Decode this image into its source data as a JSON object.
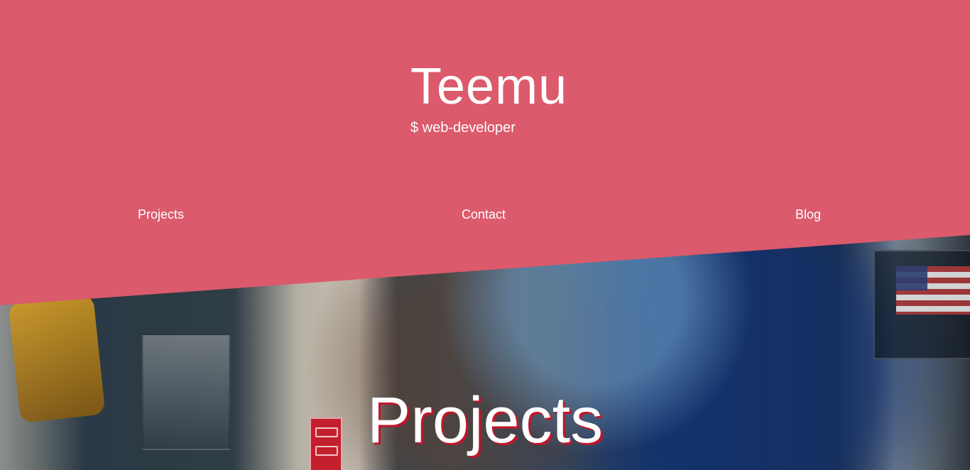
{
  "header": {
    "title": "Teemu",
    "subtitle": "$ web-developer"
  },
  "nav": {
    "items": [
      {
        "label": "Projects"
      },
      {
        "label": "Contact"
      },
      {
        "label": "Blog"
      }
    ]
  },
  "main": {
    "section_title": "Projects"
  },
  "colors": {
    "header_bg": "#db5a6b",
    "text": "#ffffff",
    "section_title_shadow": "#c2162a"
  }
}
